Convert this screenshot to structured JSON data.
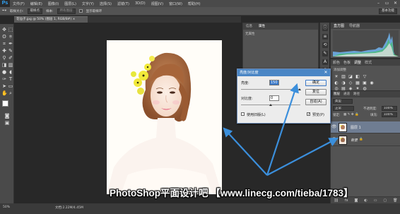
{
  "app": {
    "logo": "Ps"
  },
  "menu": [
    "文件(F)",
    "编辑(E)",
    "图像(I)",
    "图层(L)",
    "文字(Y)",
    "选择(S)",
    "滤镜(T)",
    "3D(D)",
    "视图(V)",
    "窗口(W)",
    "帮助(H)"
  ],
  "window_controls": {
    "minimize": "–",
    "restore": "▭",
    "close": "✕"
  },
  "options": {
    "size_label": "取样大小:",
    "size_value": "取样点",
    "sample_label": "样本:",
    "sample_value": "所有图层",
    "ring_label": "显示取样环",
    "workspace": "基本功能"
  },
  "document": {
    "tab": "花仙子.jpg @ 50% (图层 1, RGB/8#) ×",
    "zoom": "50%",
    "info": "文档:2.22M/4.45M"
  },
  "properties": {
    "tabs": [
      "信息",
      "属性"
    ],
    "subtitle": "无属性"
  },
  "histogram": {
    "tabs": [
      "直方图",
      "导航器"
    ]
  },
  "adjustments": {
    "tabs": [
      "颜色",
      "色板",
      "调整",
      "样式"
    ],
    "title": "添加调整",
    "icons": [
      "☀",
      "▥",
      "◪",
      "◧",
      "▽",
      "◐",
      "◑",
      "◇",
      "▦",
      "▣",
      "◉",
      "◎",
      "▤",
      "◈",
      "✦",
      "◍"
    ]
  },
  "layers": {
    "tabs": [
      "图层",
      "通道",
      "路径"
    ],
    "filter_label": "类型",
    "blend_mode": "正常",
    "opacity_label": "不透明度:",
    "opacity": "100%",
    "lock_label": "锁定:",
    "fill_label": "填充:",
    "fill": "100%",
    "items": [
      {
        "name": "图层 1",
        "selected": true
      },
      {
        "name": "背景",
        "selected": false
      }
    ],
    "footer_icons": [
      "⛓",
      "fx",
      "◙",
      "◐",
      "▭",
      "▢",
      "🗑"
    ]
  },
  "dialog": {
    "title": "亮度/对比度",
    "close": "✕",
    "brightness_label": "亮度:",
    "brightness_value": "150",
    "contrast_label": "对比度:",
    "contrast_value": "0",
    "ok": "确定",
    "reset": "复位",
    "auto": "自动(A)",
    "preview_label": "预览(P)",
    "preview_checked": true,
    "legacy_label": "使用旧版(L)",
    "legacy_checked": false
  },
  "watermark": "PhotoShop平面设计吧 【www.linecg.com/tieba/1783】",
  "colors": {
    "accent": "#4a86c5",
    "arrow": "#3b8fdc",
    "selected_layer": "#6f7d92"
  }
}
